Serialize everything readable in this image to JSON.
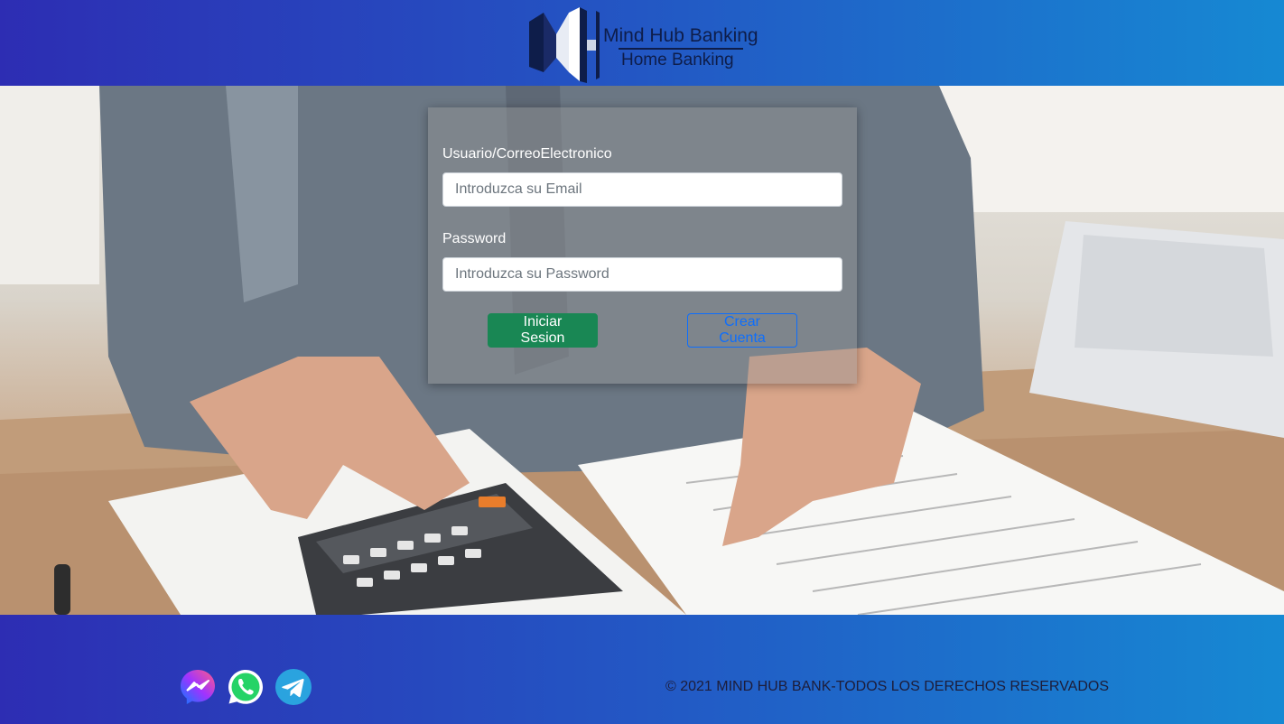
{
  "header": {
    "brand_title": "Mind Hub Banking",
    "brand_subtitle": "Home Banking",
    "logo_icon": "mh-logo-icon"
  },
  "login": {
    "user_label": "Usuario/CorreoElectronico",
    "user_placeholder": "Introduzca su Email",
    "user_value": "",
    "password_label": "Password",
    "password_placeholder": "Introduzca su Password",
    "password_value": "",
    "login_button": "Iniciar Sesion",
    "create_button": "Crear Cuenta"
  },
  "footer": {
    "social_icons": [
      "messenger-icon",
      "whatsapp-icon",
      "telegram-icon"
    ],
    "copyright": "© 2021 MIND HUB BANK-TODOS LOS DERECHOS RESERVADOS"
  },
  "colors": {
    "header_gradient_start": "#2d2db3",
    "header_gradient_end": "#1689d3",
    "login_button": "#198754",
    "create_button": "#0d6efd"
  }
}
